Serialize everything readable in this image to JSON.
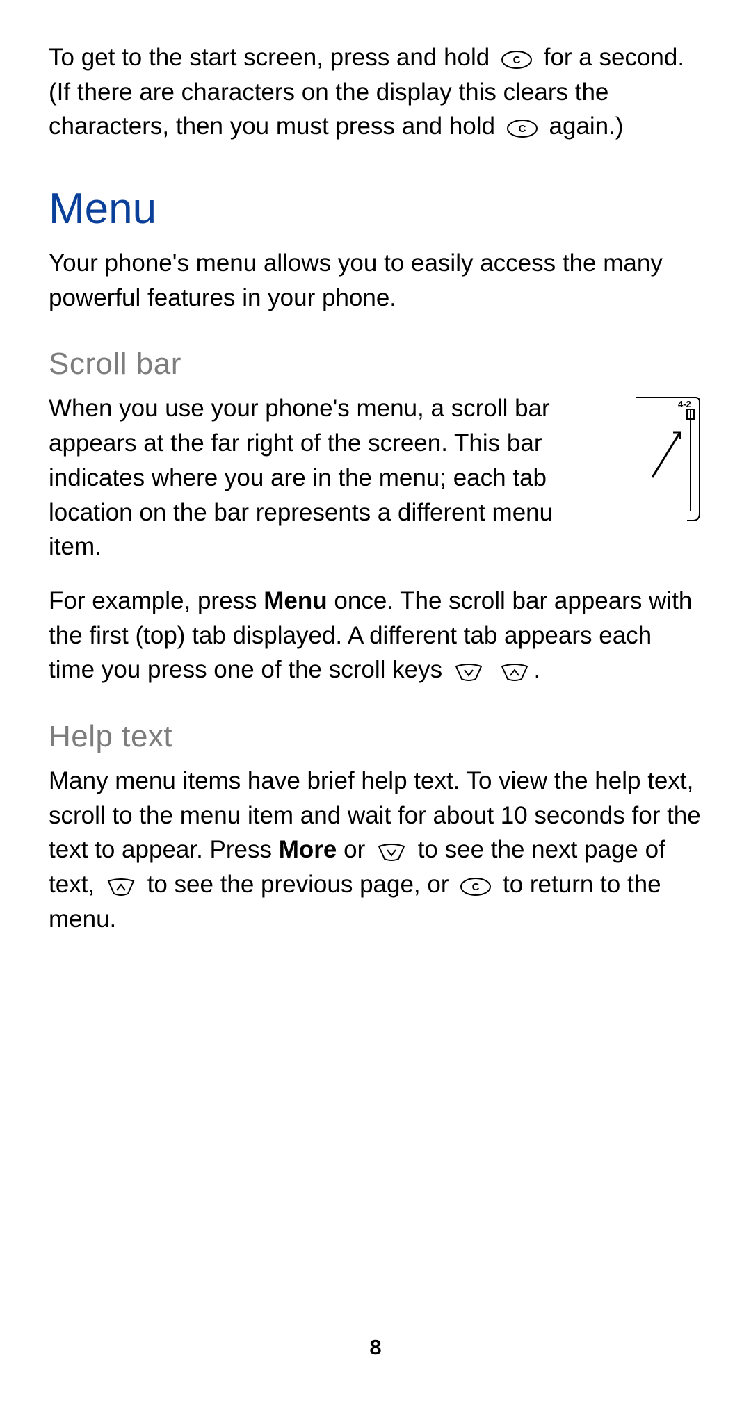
{
  "intro": {
    "p1_a": "To get to the start screen, press and hold ",
    "p1_b": " for a second. (If there are characters on the display this clears the characters, then you must press and hold ",
    "p1_c": " again.)"
  },
  "menu": {
    "heading": "Menu",
    "p1": "Your phone's menu allows you to easily access the many powerful features in your phone."
  },
  "scrollbar": {
    "heading": "Scroll bar",
    "p1": "When you use your phone's menu, a scroll bar appears at the far right of the screen. This bar indicates where you are in the menu; each tab location on the bar represents a different menu item.",
    "p2_a": "For example, press ",
    "menu_bold": "Menu",
    "p2_b": " once. The scroll bar appears with the first (top) tab displayed. A different tab appears each time you press one of the scroll keys ",
    "p2_c": ".",
    "figure_label": "4-2"
  },
  "helptext": {
    "heading": "Help text",
    "p1_a": "Many menu items have brief help text. To view the help text, scroll to the menu item and wait for about 10 seconds for the text to appear. Press ",
    "more_bold": "More",
    "p1_b": " or ",
    "p1_c": " to see the next page of text, ",
    "p1_d": " to see the previous page, or ",
    "p1_e": " to return to the menu."
  },
  "page_number": "8"
}
